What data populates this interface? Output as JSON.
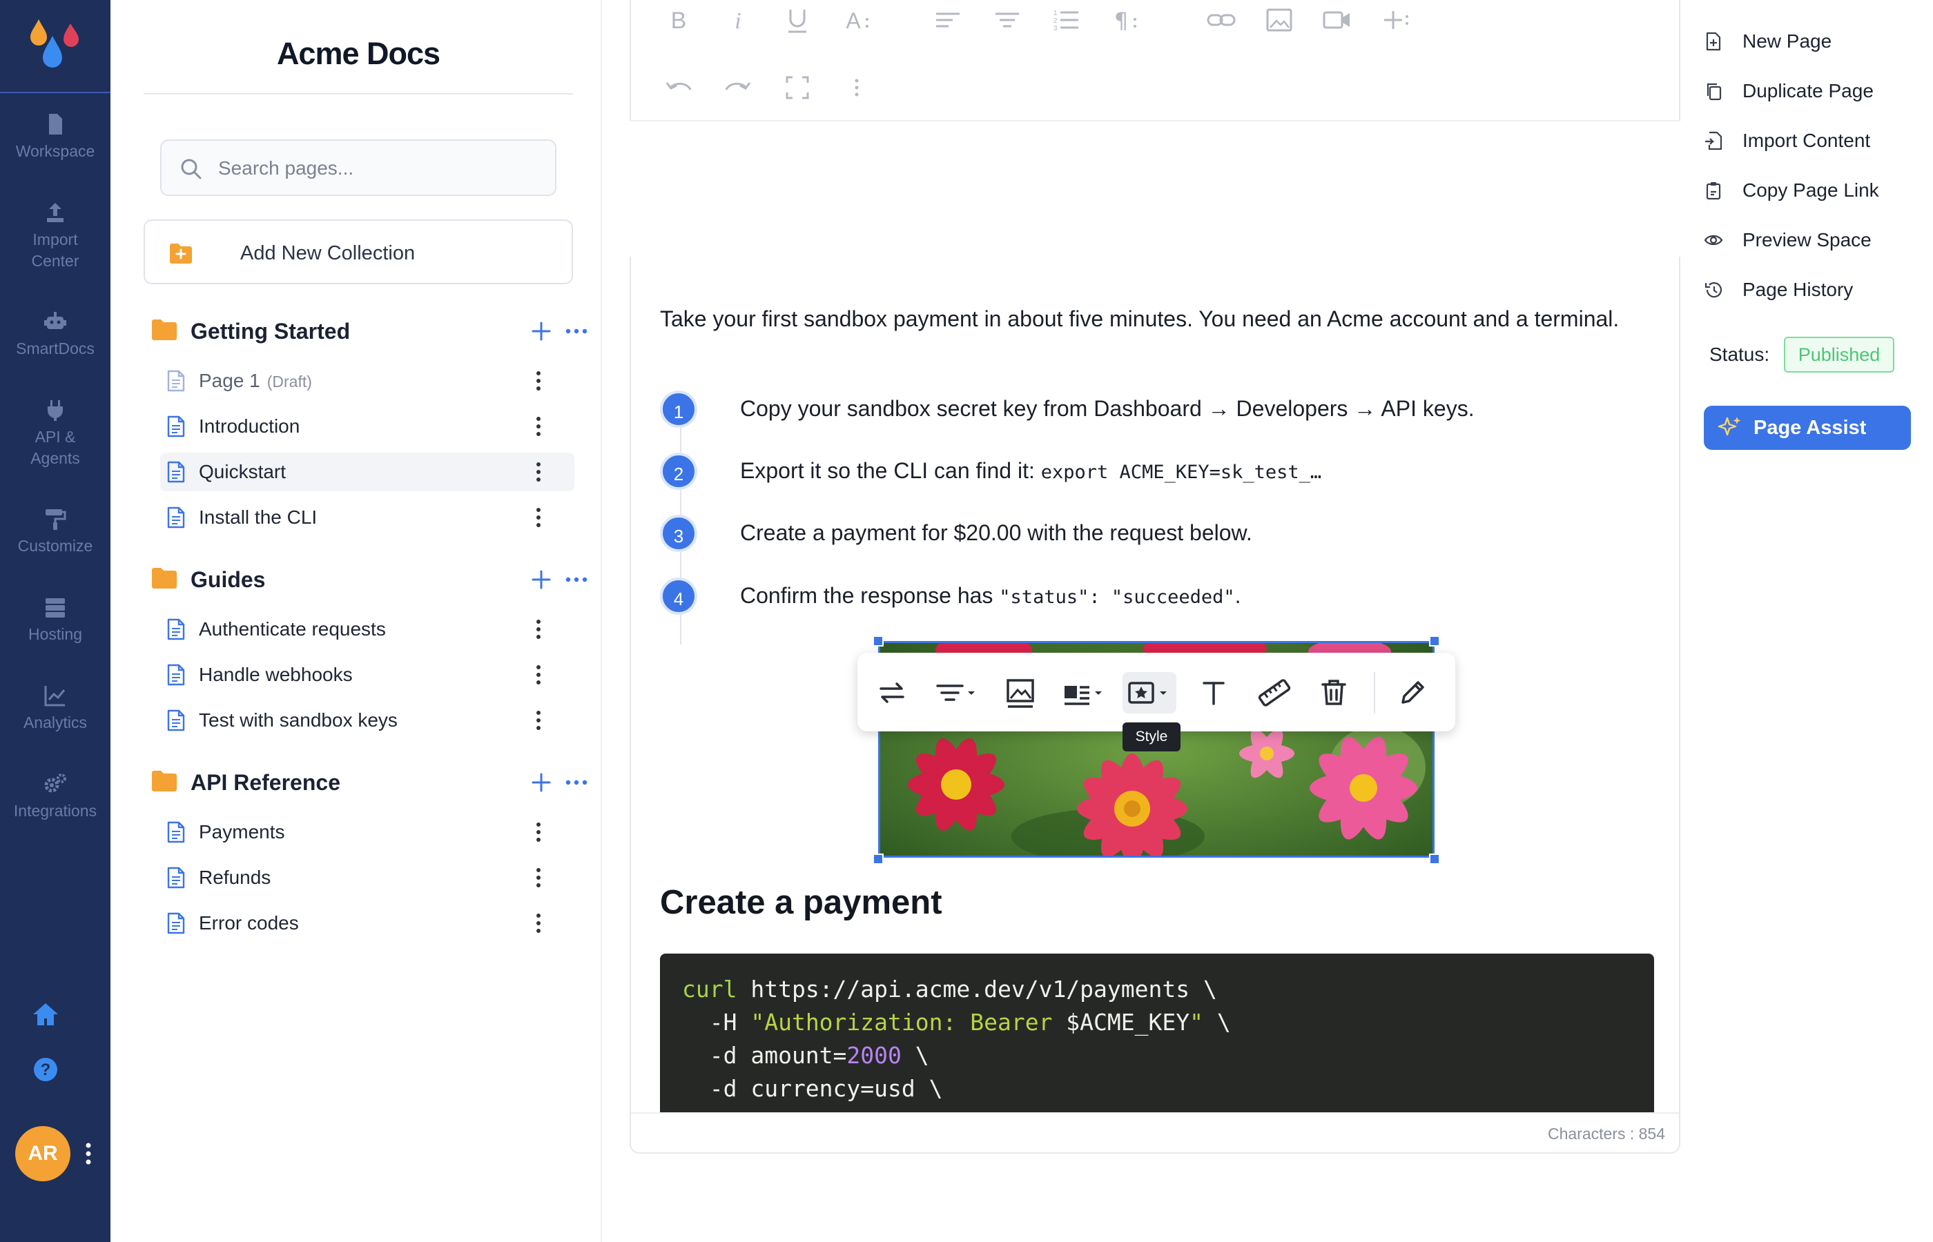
{
  "app": {
    "brand": "Acme Docs"
  },
  "rail": {
    "items": [
      {
        "label": "Workspace",
        "icon": "file-icon"
      },
      {
        "label": "Import\nCenter",
        "icon": "upload-icon"
      },
      {
        "label": "SmartDocs",
        "icon": "robot-icon"
      },
      {
        "label": "API &\nAgents",
        "icon": "plug-icon"
      },
      {
        "label": "Customize",
        "icon": "paint-roller-icon"
      },
      {
        "label": "Hosting",
        "icon": "server-icon"
      },
      {
        "label": "Analytics",
        "icon": "chart-icon"
      },
      {
        "label": "Integrations",
        "icon": "gears-icon"
      }
    ],
    "avatar_initials": "AR"
  },
  "sidebar": {
    "search_placeholder": "Search pages...",
    "add_collection_label": "Add New Collection",
    "groups": [
      {
        "title": "Getting Started",
        "pages": [
          {
            "label": "Page 1",
            "badge": "(Draft)"
          },
          {
            "label": "Introduction"
          },
          {
            "label": "Quickstart",
            "active": true
          },
          {
            "label": "Install the CLI"
          }
        ]
      },
      {
        "title": "Guides",
        "pages": [
          {
            "label": "Authenticate requests"
          },
          {
            "label": "Handle webhooks"
          },
          {
            "label": "Test with sandbox keys"
          }
        ]
      },
      {
        "title": "API Reference",
        "pages": [
          {
            "label": "Payments"
          },
          {
            "label": "Refunds"
          },
          {
            "label": "Error codes"
          }
        ]
      }
    ]
  },
  "editor": {
    "intro": "Take your first sandbox payment in about five minutes. You need an Acme account and a terminal.",
    "steps": [
      {
        "number": "1",
        "text": "Copy your sandbox secret key from Dashboard → Developers → API keys.",
        "code": ""
      },
      {
        "number": "2",
        "text": "Export it so the CLI can find it: ",
        "code": "export ACME_KEY=sk_test_…"
      },
      {
        "number": "3",
        "text": "Create a payment for $20.00 with the request below.",
        "code": ""
      },
      {
        "number": "4",
        "text": "Confirm the response has ",
        "code": "\"status\": \"succeeded\"",
        "tail": "."
      }
    ],
    "image_alt": "Pink and red dahlia flowers",
    "image_tooltip": "Style",
    "heading": "Create a payment",
    "code_lines": [
      [
        {
          "t": "curl",
          "c": "kw"
        },
        {
          "t": " https://api.acme.dev/v1/payments \\",
          "c": ""
        }
      ],
      [
        {
          "t": "  -H ",
          "c": ""
        },
        {
          "t": "\"Authorization: Bearer",
          "c": "str"
        },
        {
          "t": " $ACME_KEY",
          "c": ""
        },
        {
          "t": "\"",
          "c": "str"
        },
        {
          "t": " \\",
          "c": ""
        }
      ],
      [
        {
          "t": "  -d amount=",
          "c": ""
        },
        {
          "t": "2000",
          "c": "num"
        },
        {
          "t": " \\",
          "c": ""
        }
      ],
      [
        {
          "t": "  -d currency=usd \\",
          "c": ""
        }
      ]
    ],
    "char_count": "Characters : 854"
  },
  "right_panel": {
    "actions": [
      {
        "label": "New Page",
        "icon": "file-plus-icon"
      },
      {
        "label": "Duplicate Page",
        "icon": "copy-icon"
      },
      {
        "label": "Import Content",
        "icon": "file-import-icon"
      },
      {
        "label": "Copy Page Link",
        "icon": "clipboard-link-icon"
      },
      {
        "label": "Preview Space",
        "icon": "eye-icon"
      },
      {
        "label": "Page History",
        "icon": "history-icon"
      }
    ],
    "status_label": "Status:",
    "status_value": "Published",
    "assist_label": "Page Assist"
  },
  "colors": {
    "rail_bg": "#1e2f5a",
    "accent": "#3b74e6",
    "folder": "#f3a233",
    "published": "#4cc674"
  }
}
